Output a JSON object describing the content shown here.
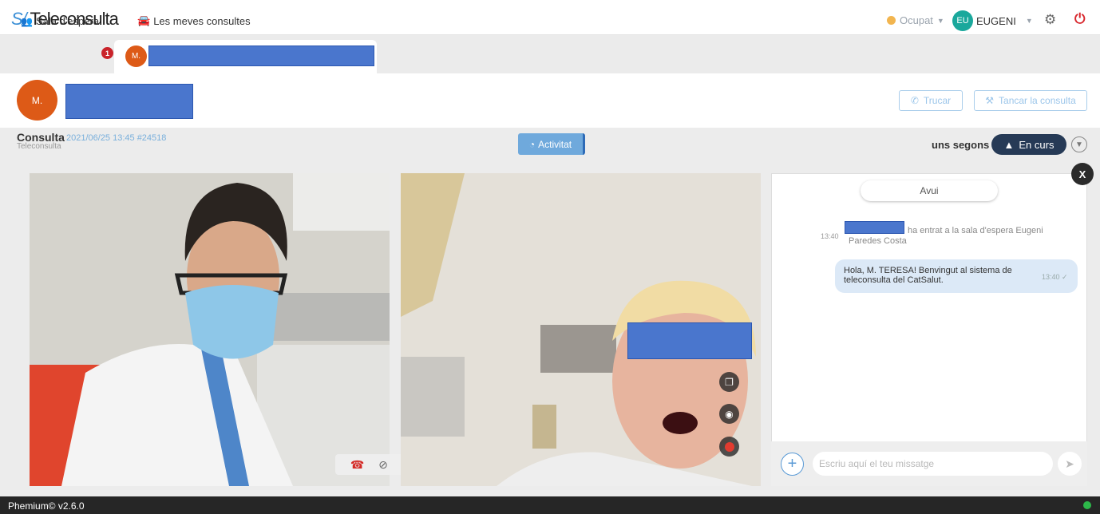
{
  "header": {
    "logo_prefix": "S/",
    "logo_text": "Teleconsulta",
    "nav_link": "Les meves consultes",
    "status_label": "Ocupat",
    "user_initials": "EU",
    "user_name": "EUGENI",
    "status_color": "#f2b54f"
  },
  "tabs": {
    "waiting_room": "Sala d'espera",
    "waiting_badge": "1",
    "patient_initial": "M."
  },
  "patient": {
    "initial": "M.",
    "call_button": "Trucar",
    "close_button": "Tancar la consulta"
  },
  "consult": {
    "title": "Consulta",
    "meta": "2021/06/25 13:45 #24518",
    "subtitle": "Teleconsulta",
    "activity_button": "Activitat",
    "elapsed": "uns segons",
    "status_pill": "En curs"
  },
  "chat": {
    "close": "X",
    "day_label": "Avui",
    "system_time": "13:40",
    "system_message_part1": "ha entrat a la sala d'espera Eugeni",
    "system_message_part2": "Paredes Costa",
    "message_text": "Hola, M. TERESA! Benvingut al sistema de teleconsulta del CatSalut.",
    "message_time": "13:40 ✓",
    "input_placeholder": "Escriu aquí el teu missatge"
  },
  "footer": {
    "version": "Phemium© v2.6.0"
  }
}
